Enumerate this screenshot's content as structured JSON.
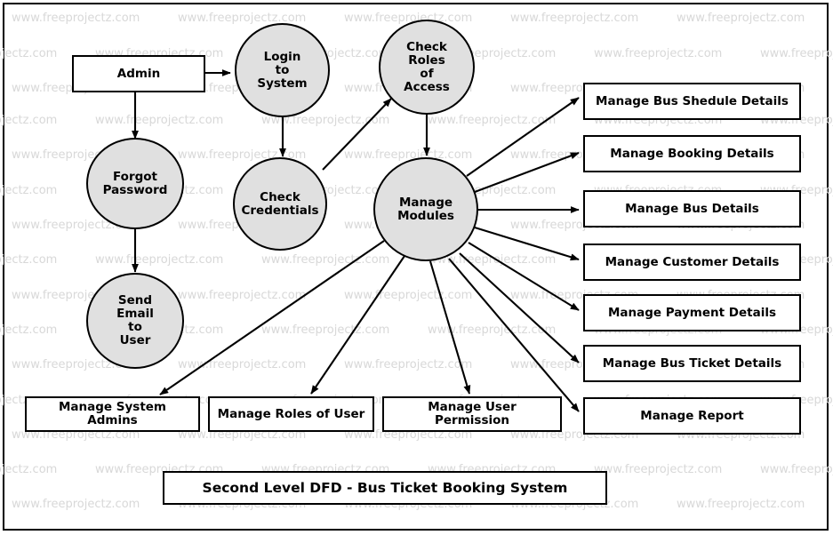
{
  "diagram": {
    "title": "Second Level DFD - Bus Ticket Booking System",
    "watermark_text": "www.freeprojectz.com",
    "colors": {
      "process_fill": "#e0e0e0",
      "stroke": "#000000",
      "entity_fill": "#ffffff",
      "watermark": "#d8d8d8"
    }
  },
  "entities": {
    "admin": "Admin"
  },
  "processes": {
    "login_to_system": "Login\nto\nSystem",
    "login_to_system_lines": [
      "Login",
      "to",
      "System"
    ],
    "check_roles_of_access_lines": [
      "Check",
      "Roles",
      "of",
      "Access"
    ],
    "forgot_password_lines": [
      "Forgot",
      "Password"
    ],
    "check_credentials_lines": [
      "Check",
      "Credentials"
    ],
    "send_email_to_user_lines": [
      "Send",
      "Email",
      "to",
      "User"
    ],
    "manage_modules_lines": [
      "Manage",
      "Modules"
    ]
  },
  "right_stores": [
    {
      "label": "Manage Bus Shedule Details"
    },
    {
      "label": "Manage Booking Details"
    },
    {
      "label": "Manage Bus Details"
    },
    {
      "label": "Manage Customer Details"
    },
    {
      "label": "Manage Payment Details"
    },
    {
      "label": "Manage Bus Ticket Details"
    },
    {
      "label": "Manage Report"
    }
  ],
  "bottom_stores": [
    {
      "label": "Manage System Admins"
    },
    {
      "label": "Manage Roles of User"
    },
    {
      "label": "Manage User Permission"
    }
  ]
}
